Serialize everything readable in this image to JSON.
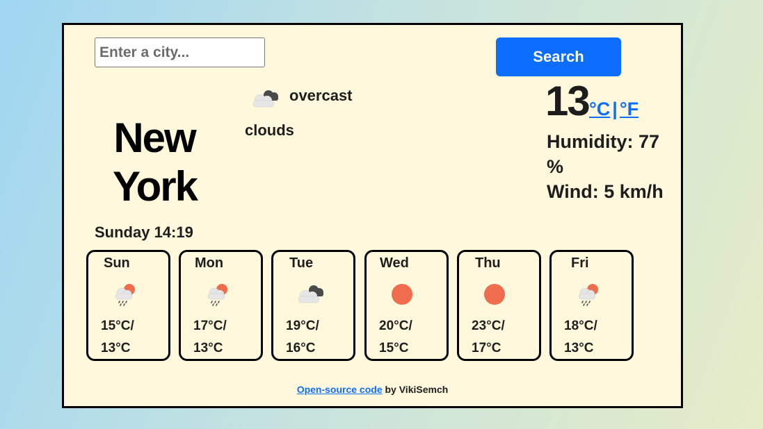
{
  "search": {
    "placeholder": "Enter a city...",
    "button_label": "Search"
  },
  "current": {
    "city_line1": "New",
    "city_line2": "York",
    "description": "overcast",
    "description_sub": "clouds",
    "icon": "overcast-clouds-icon",
    "temperature": "13",
    "unit_celsius": "°C",
    "unit_separator": "|",
    "unit_fahrenheit": "°F",
    "humidity_label": "Humidity:",
    "humidity_value": "77",
    "humidity_unit": "%",
    "wind_label": "Wind:",
    "wind_value": "5 km/h",
    "datetime": "Sunday 14:19"
  },
  "forecast": [
    {
      "day": "Sun",
      "icon": "sun-rain-icon",
      "max": "15°C/",
      "min": "13°C"
    },
    {
      "day": "Mon",
      "icon": "sun-rain-icon",
      "max": "17°C/",
      "min": "13°C"
    },
    {
      "day": "Tue",
      "icon": "overcast-clouds-icon",
      "max": "19°C/",
      "min": "16°C"
    },
    {
      "day": "Wed",
      "icon": "sun-icon",
      "max": "20°C/",
      "min": "15°C"
    },
    {
      "day": "Thu",
      "icon": "sun-icon",
      "max": "23°C/",
      "min": "17°C"
    },
    {
      "day": "Fri",
      "icon": "sun-rain-icon",
      "max": "18°C/",
      "min": "13°C"
    }
  ],
  "footer": {
    "link_text": "Open-source code",
    "suffix": " by VikiSemch"
  },
  "colors": {
    "accent": "#0d6efd",
    "card_bg": "#fff8dc",
    "sun": "#ef6c4c",
    "cloud": "#e6e6e6",
    "cloud_dark": "#4a4a4a"
  }
}
